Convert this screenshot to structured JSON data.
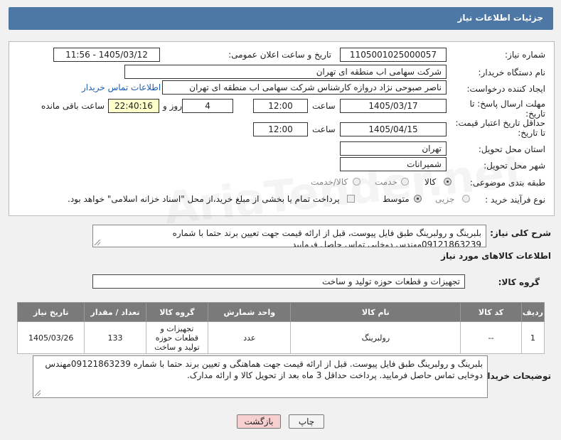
{
  "header": {
    "title": "جزئیات اطلاعات نیاز"
  },
  "fields": {
    "need_number_label": "شماره نیاز:",
    "need_number": "1105001025000057",
    "announce_label": "تاریخ و ساعت اعلان عمومی:",
    "announce_value": "1405/03/12 - 11:56",
    "buyer_org_label": "نام دستگاه خریدار:",
    "buyer_org": "شرکت سهامی اب منطقه ای تهران",
    "creator_label": "ایجاد کننده درخواست:",
    "creator": "ناصر صبوحی نژاد دروازه کارشناس شرکت سهامی اب منطقه ای تهران",
    "contact_link": "اطلاعات تماس خریدار",
    "reply_deadline_label": "مهلت ارسال پاسخ: تا تاریخ:",
    "reply_date": "1405/03/17",
    "time_label": "ساعت",
    "reply_time": "12:00",
    "days_value": "4",
    "days_label": "روز و",
    "remaining_time": "22:40:16",
    "remaining_label": "ساعت باقی مانده",
    "price_validity_label": "حداقل تاریخ اعتبار قیمت: تا تاریخ:",
    "price_date": "1405/04/15",
    "price_time": "12:00",
    "province_label": "استان محل تحویل:",
    "province": "تهران",
    "city_label": "شهر محل تحویل:",
    "city": "شمیرانات",
    "category_label": "طبقه بندی موضوعی:",
    "cat_goods": "کالا",
    "cat_service": "خدمت",
    "cat_both": "کالا/خدمت",
    "process_label": "نوع فرآیند خرید :",
    "proc_partial": "جزیی",
    "proc_medium": "متوسط",
    "payment_note": "پرداخت تمام یا بخشی از مبلغ خرید،از محل \"اسناد خزانه اسلامی\" خواهد بود."
  },
  "summary": {
    "label": "شرح کلی نیاز:",
    "text": "بلبرینگ و رولبرینگ طبق فایل پیوست، قبل از ارائه قیمت جهت تعیین برند حتما با شماره 09121863239مهندس دوخایی تماس حاصل فرمایید"
  },
  "goods_section": {
    "title": "اطلاعات کالاهای مورد نیاز",
    "group_label": "گروه کالا:",
    "group_value": "تجهیزات و قطعات حوزه تولید و ساخت"
  },
  "table": {
    "headers": [
      "ردیف",
      "کد کالا",
      "نام کالا",
      "واحد شمارش",
      "گروه کالا",
      "تعداد / مقدار",
      "تاریخ نیاز"
    ],
    "rows": [
      [
        "1",
        "--",
        "رولبرینگ",
        "عدد",
        "تجهیزات و قطعات حوزه تولید و ساخت",
        "133",
        "1405/03/26"
      ]
    ]
  },
  "buyer_notes": {
    "label": "توضیحات خریدار:",
    "text": "بلبرینگ و رولبرینگ طبق فایل پیوست. قبل از ارائه قیمت جهت هماهنگی و تعیین برند حتما با شماره 09121863239مهندس دوخایی تماس حاصل فرمایید. پرداخت حداقل 3 ماه بعد از تحویل کالا و ارائه مدارک."
  },
  "buttons": {
    "print": "چاپ",
    "back": "بازگشت"
  },
  "watermark": "AriaTender.net",
  "colors": {
    "title_bar": "#4d78a6",
    "table_header": "#7a7a7a",
    "highlight": "#ffffcc",
    "back_button": "#f6d0d0"
  }
}
